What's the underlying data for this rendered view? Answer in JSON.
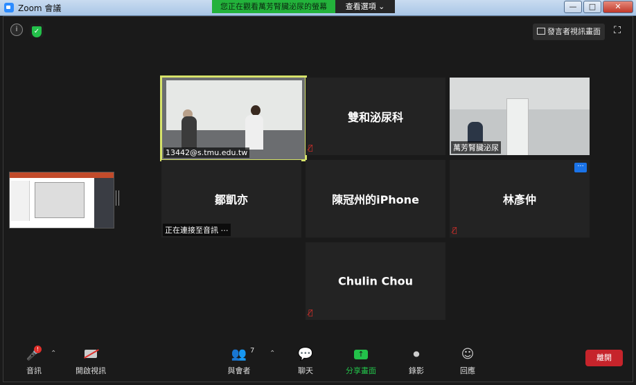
{
  "window": {
    "title": "Zoom 會議"
  },
  "banner": {
    "text": "您正在觀看萬芳腎臟泌尿的螢幕",
    "view_options": "查看選項"
  },
  "window_controls": {
    "minimize": "—",
    "maximize": "□",
    "close": "✕"
  },
  "top_right": {
    "speaker_view": "發言者視訊畫面",
    "fullscreen": "⛶"
  },
  "top_left": {
    "info": "i",
    "shield": "✓"
  },
  "tiles": [
    {
      "caption": "13442@s.tmu.edu.tw",
      "type": "video"
    },
    {
      "name": "雙和泌尿科",
      "type": "name"
    },
    {
      "caption": "萬芳腎臟泌尿",
      "type": "room"
    },
    {
      "name": "鄒凱亦",
      "caption": "正在連接至音訊 ⋯",
      "type": "name"
    },
    {
      "name": "陳冠州的iPhone",
      "type": "name"
    },
    {
      "name": "林彥仲",
      "type": "name",
      "more": "···"
    },
    {
      "name": "Chulin Chou",
      "type": "name"
    }
  ],
  "toolbar": {
    "audio": "音訊",
    "audio_badge": "!",
    "video": "開啟視訊",
    "participants": "與會者",
    "participants_count": "7",
    "chat": "聊天",
    "share": "分享畫面",
    "record": "錄影",
    "reactions": "回應",
    "leave": "離開",
    "caret": "⌃"
  },
  "colors": {
    "active_speaker_border": "#d7e36a",
    "share_green": "#23c14a",
    "leave_red": "#c6242b",
    "mute_red": "#e0302b"
  }
}
